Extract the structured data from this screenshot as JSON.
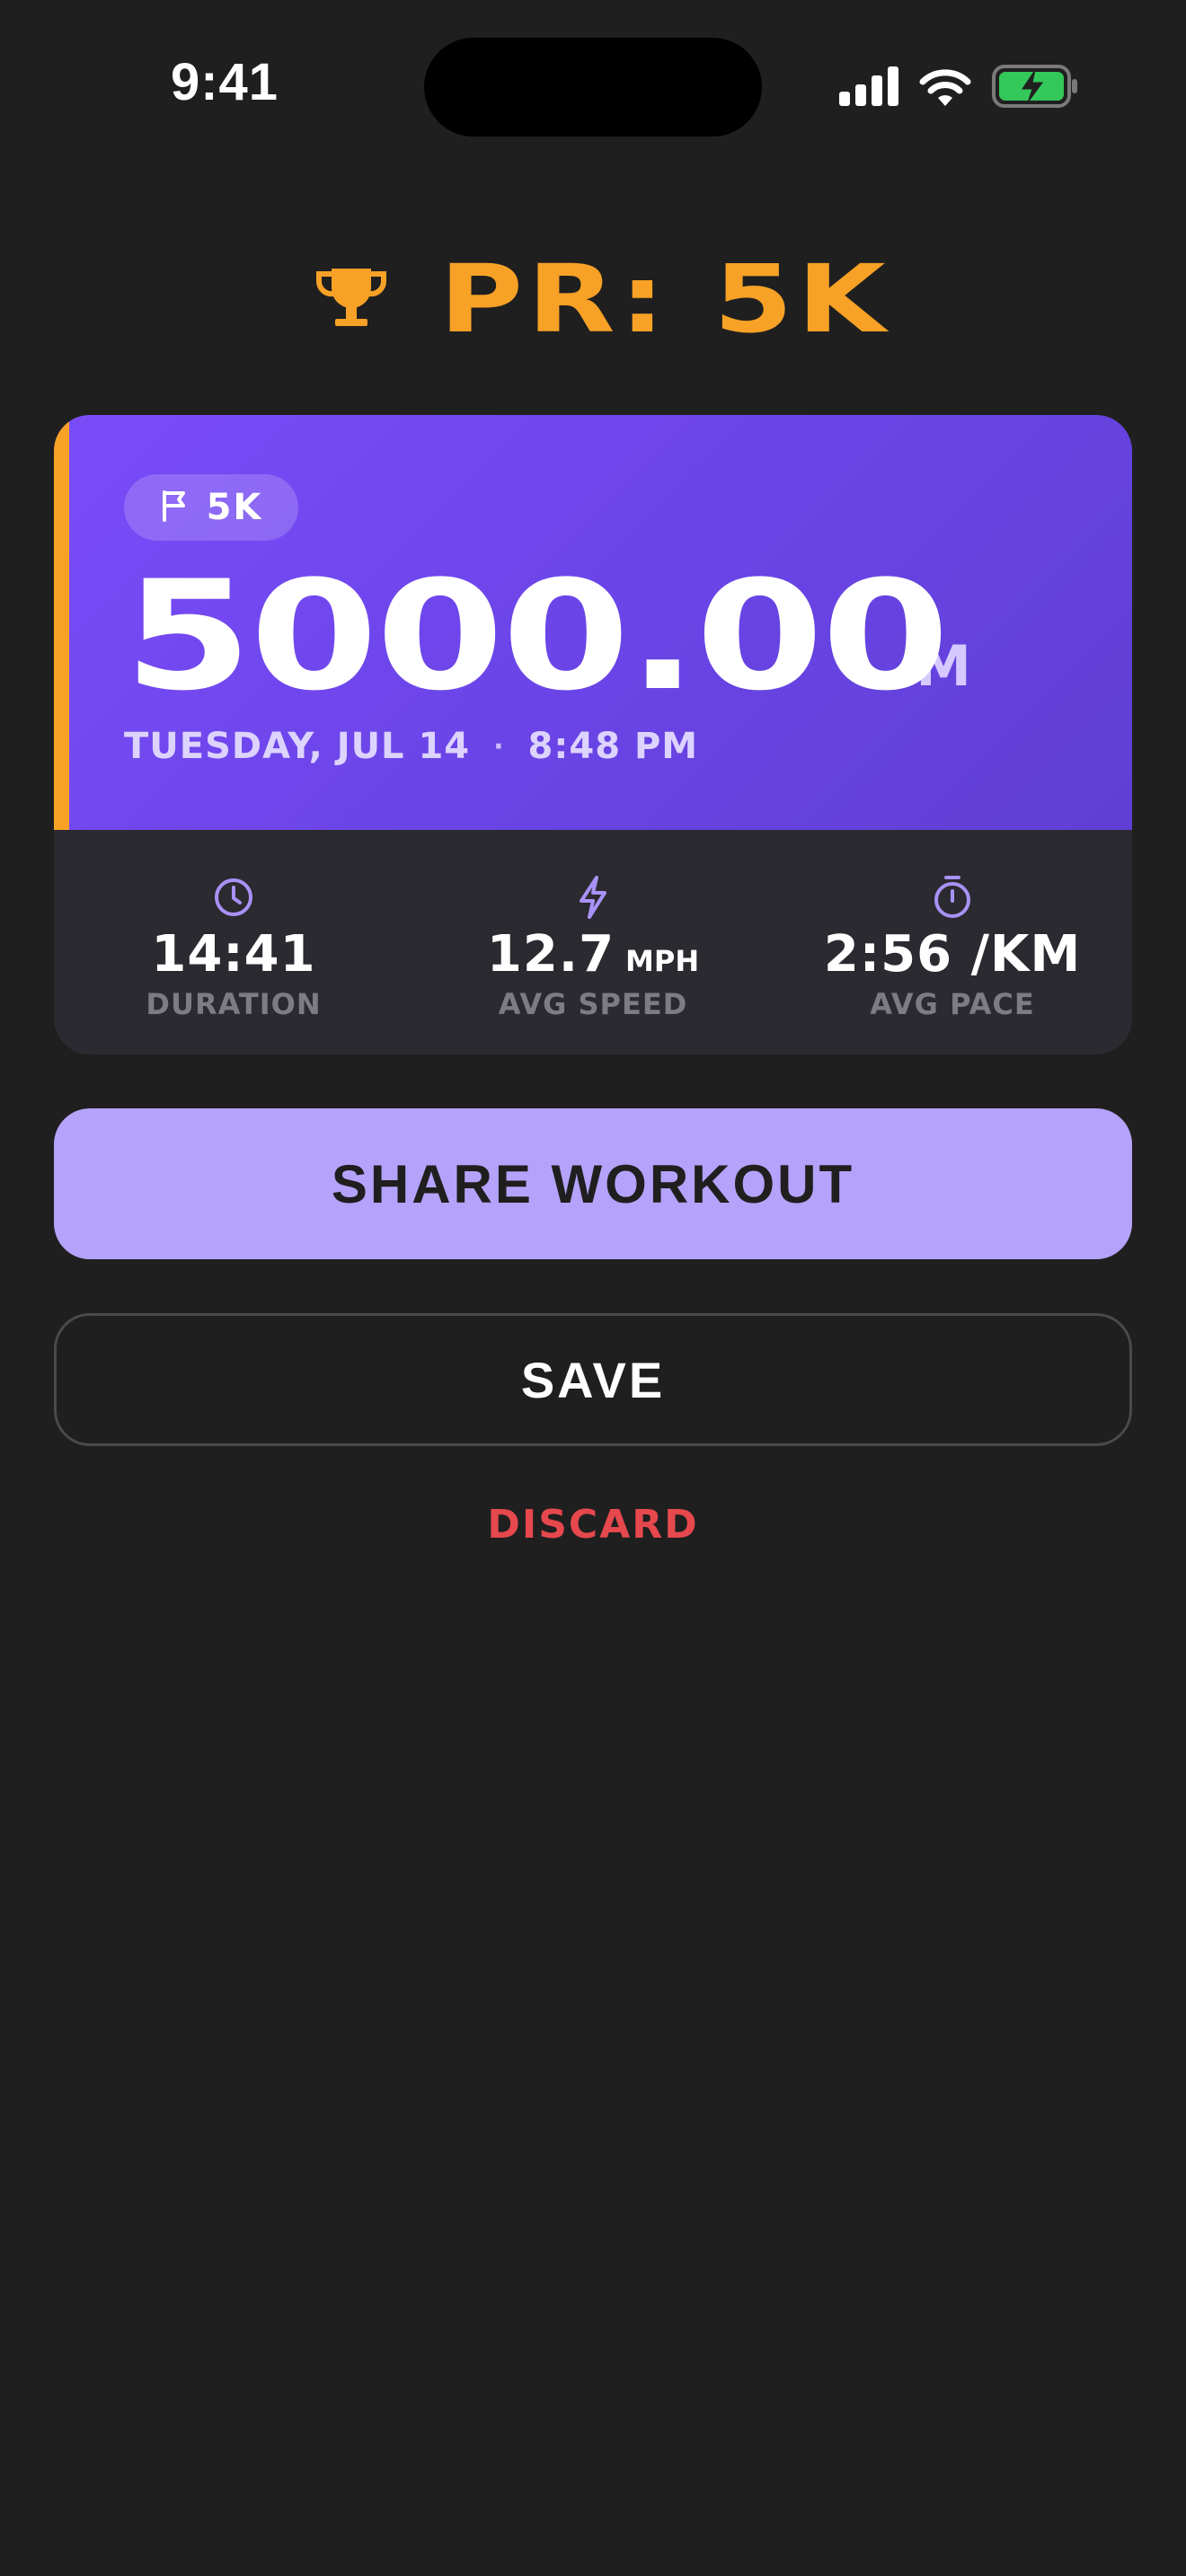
{
  "status_bar": {
    "time": "9:41",
    "battery_color": "#34c759"
  },
  "header": {
    "title": "PR: 5K",
    "icon": "trophy-icon",
    "accent_color": "#f7a126"
  },
  "workout_card": {
    "chip": {
      "icon": "flag-icon",
      "label": "5K"
    },
    "distance_value": "5000.00",
    "distance_unit": "M",
    "date": "TUESDAY, JUL 14",
    "separator": "·",
    "time": "8:48 PM",
    "hero_gradient": [
      "#7a4cf9",
      "#5f3fd3"
    ],
    "stats": [
      {
        "icon": "clock-icon",
        "value": "14:41",
        "unit": "",
        "label": "DURATION"
      },
      {
        "icon": "lightning-icon",
        "value": "12.7",
        "unit": "MPH",
        "label": "AVG SPEED"
      },
      {
        "icon": "stopwatch-icon",
        "value": "2:56 /KM",
        "unit": "",
        "label": "AVG PACE"
      }
    ]
  },
  "actions": {
    "share_label": "SHARE WORKOUT",
    "save_label": "SAVE",
    "discard_label": "DISCARD",
    "share_color": "#b5a2fb",
    "discard_color": "#e5484d"
  }
}
